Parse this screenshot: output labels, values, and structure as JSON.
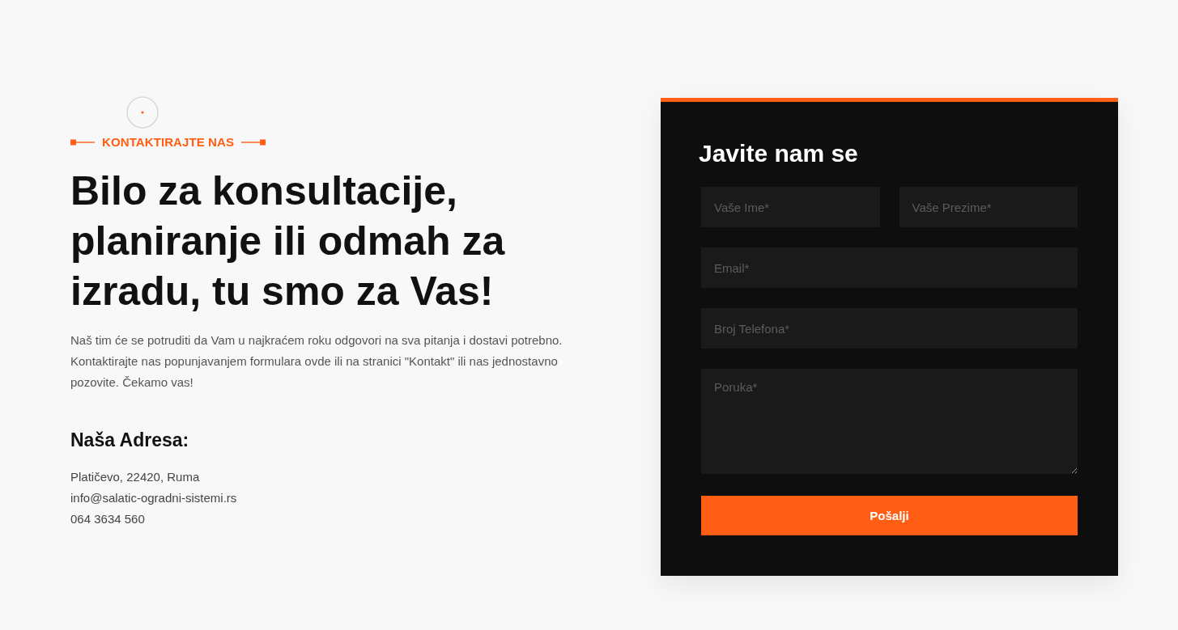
{
  "intro": {
    "tagline": "KONTAKTIRAJTE NAS",
    "heading": "Bilo za konsultacije, planiranje ili odmah za izradu, tu smo za Vas!",
    "description": "Naš tim će se potruditi da Vam u najkraćem roku odgovori na sva pitanja i dostavi potrebno. Kontaktirajte nas popunjavanjem formulara ovde ili na stranici \"Kontakt\" ili nas jednostavno pozovite. Čekamo vas!",
    "address_title": "Naša Adresa:",
    "address_lines": [
      "Platičevo, 22420, Ruma",
      "info@salatic-ogradni-sistemi.rs",
      "064 3634 560"
    ]
  },
  "form": {
    "title": "Javite nam se",
    "rows": [
      [
        {
          "kind": "input",
          "placeholder": "Vaše Ime*"
        },
        {
          "kind": "input",
          "placeholder": "Vaše Prezime*"
        }
      ],
      [
        {
          "kind": "input",
          "placeholder": "Email*"
        }
      ],
      [
        {
          "kind": "input",
          "placeholder": "Broj Telefona*"
        }
      ],
      [
        {
          "kind": "textarea",
          "placeholder": "Poruka*"
        }
      ]
    ],
    "submit": "Pošalji"
  }
}
